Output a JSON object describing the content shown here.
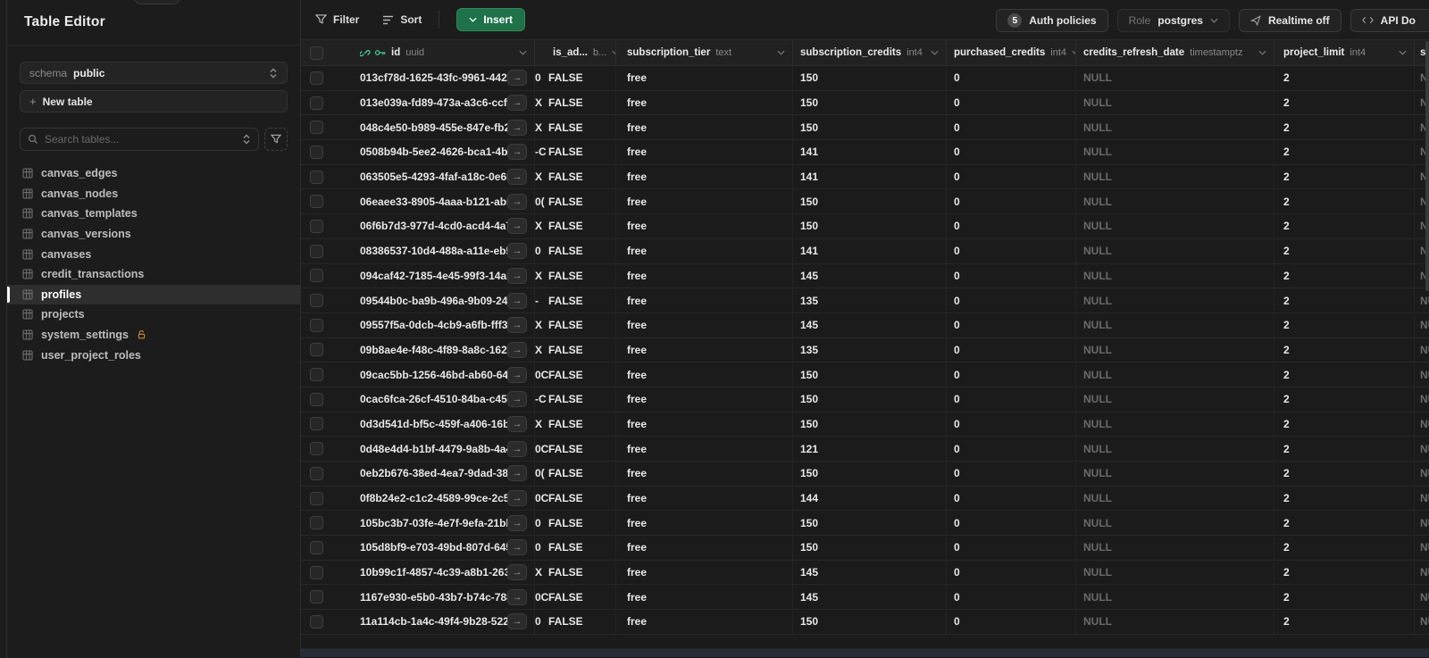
{
  "sidebar": {
    "title": "Table Editor",
    "schema_label": "schema",
    "schema_value": "public",
    "new_table_label": "New table",
    "search_placeholder": "Search tables...",
    "tables": [
      {
        "name": "canvas_edges"
      },
      {
        "name": "canvas_nodes"
      },
      {
        "name": "canvas_templates"
      },
      {
        "name": "canvas_versions"
      },
      {
        "name": "canvases"
      },
      {
        "name": "credit_transactions"
      },
      {
        "name": "profiles",
        "selected": true
      },
      {
        "name": "projects"
      },
      {
        "name": "system_settings",
        "locked": true
      },
      {
        "name": "user_project_roles"
      }
    ]
  },
  "toolbar": {
    "filter_label": "Filter",
    "sort_label": "Sort",
    "insert_label": "Insert",
    "auth_policies_count": "5",
    "auth_policies_label": "Auth policies",
    "role_label": "Role",
    "role_value": "postgres",
    "realtime_label": "Realtime off",
    "api_docs_label": "API Do"
  },
  "icons": {
    "filter": "funnel-icon",
    "sort": "list-icon",
    "insert_chevron": "chevron-down-icon",
    "search": "magnifier-icon",
    "schema_select": "chevrons-up-down-icon",
    "new_table": "plus-icon",
    "table_item": "table-grid-icon",
    "system_settings_lock": "lock-open-icon",
    "id_link": "chain-icon",
    "id_key": "key-icon",
    "expand_row": "arrow-right-icon",
    "realtime": "send-icon",
    "api_docs": "code-brackets-icon"
  },
  "colors": {
    "accent_green": "#3ecf8e",
    "insert_button": "#1e7148",
    "lock_orange": "#c98a2e",
    "background": "#171717"
  },
  "grid": {
    "columns": [
      {
        "key": "id",
        "name": "id",
        "type": "uuid",
        "pk": true
      },
      {
        "key": "frag",
        "name": "",
        "type": ""
      },
      {
        "key": "is_admin",
        "name": "is_ad...",
        "type": "b..."
      },
      {
        "key": "tier",
        "name": "subscription_tier",
        "type": "text"
      },
      {
        "key": "credits",
        "name": "subscription_credits",
        "type": "int4"
      },
      {
        "key": "purchased",
        "name": "purchased_credits",
        "type": "int4"
      },
      {
        "key": "refresh",
        "name": "credits_refresh_date",
        "type": "timestamptz"
      },
      {
        "key": "limit",
        "name": "project_limit",
        "type": "int4"
      },
      {
        "key": "extra",
        "name": "su",
        "type": ""
      }
    ],
    "rows": [
      {
        "id": "013cf78d-1625-43fc-9961-442189...",
        "frag": "0",
        "is_admin": "FALSE",
        "tier": "free",
        "credits": "150",
        "purchased": "0",
        "refresh": "NULL",
        "limit": "2",
        "extra": "NULL"
      },
      {
        "id": "013e039a-fd89-473a-a3c6-ccfa9...",
        "frag": "X",
        "is_admin": "FALSE",
        "tier": "free",
        "credits": "150",
        "purchased": "0",
        "refresh": "NULL",
        "limit": "2",
        "extra": "NULL"
      },
      {
        "id": "048c4e50-b989-455e-847e-fb2f...",
        "frag": "X",
        "is_admin": "FALSE",
        "tier": "free",
        "credits": "150",
        "purchased": "0",
        "refresh": "NULL",
        "limit": "2",
        "extra": "NULL"
      },
      {
        "id": "0508b94b-5ee2-4626-bca1-4bca...",
        "frag": "-C",
        "is_admin": "FALSE",
        "tier": "free",
        "credits": "141",
        "purchased": "0",
        "refresh": "NULL",
        "limit": "2",
        "extra": "NULL"
      },
      {
        "id": "063505e5-4293-4faf-a18c-0e65b...",
        "frag": "X",
        "is_admin": "FALSE",
        "tier": "free",
        "credits": "141",
        "purchased": "0",
        "refresh": "NULL",
        "limit": "2",
        "extra": "NULL"
      },
      {
        "id": "06eaee33-8905-4aaa-b121-ab552...",
        "frag": "0(",
        "is_admin": "FALSE",
        "tier": "free",
        "credits": "150",
        "purchased": "0",
        "refresh": "NULL",
        "limit": "2",
        "extra": "NULL"
      },
      {
        "id": "06f6b7d3-977d-4cd0-acd4-4a78...",
        "frag": "X",
        "is_admin": "FALSE",
        "tier": "free",
        "credits": "150",
        "purchased": "0",
        "refresh": "NULL",
        "limit": "2",
        "extra": "NULL"
      },
      {
        "id": "08386537-10d4-488a-a11e-eb5a6...",
        "frag": "0",
        "is_admin": "FALSE",
        "tier": "free",
        "credits": "141",
        "purchased": "0",
        "refresh": "NULL",
        "limit": "2",
        "extra": "NULL"
      },
      {
        "id": "094caf42-7185-4e45-99f3-14abee...",
        "frag": "X",
        "is_admin": "FALSE",
        "tier": "free",
        "credits": "145",
        "purchased": "0",
        "refresh": "NULL",
        "limit": "2",
        "extra": "NULL"
      },
      {
        "id": "09544b0c-ba9b-496a-9b09-244...",
        "frag": "-",
        "is_admin": "FALSE",
        "tier": "free",
        "credits": "135",
        "purchased": "0",
        "refresh": "NULL",
        "limit": "2",
        "extra": "NULL"
      },
      {
        "id": "09557f5a-0dcb-4cb9-a6fb-fff366...",
        "frag": "X",
        "is_admin": "FALSE",
        "tier": "free",
        "credits": "145",
        "purchased": "0",
        "refresh": "NULL",
        "limit": "2",
        "extra": "NULL"
      },
      {
        "id": "09b8ae4e-f48c-4f89-8a8c-1629b...",
        "frag": "X",
        "is_admin": "FALSE",
        "tier": "free",
        "credits": "135",
        "purchased": "0",
        "refresh": "NULL",
        "limit": "2",
        "extra": "NULL"
      },
      {
        "id": "09cac5bb-1256-46bd-ab60-64ed...",
        "frag": "0C",
        "is_admin": "FALSE",
        "tier": "free",
        "credits": "150",
        "purchased": "0",
        "refresh": "NULL",
        "limit": "2",
        "extra": "NULL"
      },
      {
        "id": "0cac6fca-26cf-4510-84ba-c4580...",
        "frag": "-C",
        "is_admin": "FALSE",
        "tier": "free",
        "credits": "150",
        "purchased": "0",
        "refresh": "NULL",
        "limit": "2",
        "extra": "NULL"
      },
      {
        "id": "0d3d541d-bf5c-459f-a406-16b93...",
        "frag": "X",
        "is_admin": "FALSE",
        "tier": "free",
        "credits": "150",
        "purchased": "0",
        "refresh": "NULL",
        "limit": "2",
        "extra": "NULL"
      },
      {
        "id": "0d48e4d4-b1bf-4479-9a8b-4a4b...",
        "frag": "0C",
        "is_admin": "FALSE",
        "tier": "free",
        "credits": "121",
        "purchased": "0",
        "refresh": "NULL",
        "limit": "2",
        "extra": "NULL"
      },
      {
        "id": "0eb2b676-38ed-4ea7-9dad-38e6...",
        "frag": "0(",
        "is_admin": "FALSE",
        "tier": "free",
        "credits": "150",
        "purchased": "0",
        "refresh": "NULL",
        "limit": "2",
        "extra": "NULL"
      },
      {
        "id": "0f8b24e2-c1c2-4589-99ce-2c52d...",
        "frag": "0C",
        "is_admin": "FALSE",
        "tier": "free",
        "credits": "144",
        "purchased": "0",
        "refresh": "NULL",
        "limit": "2",
        "extra": "NULL"
      },
      {
        "id": "105bc3b7-03fe-4e7f-9efa-21bb40...",
        "frag": "0",
        "is_admin": "FALSE",
        "tier": "free",
        "credits": "150",
        "purchased": "0",
        "refresh": "NULL",
        "limit": "2",
        "extra": "NULL"
      },
      {
        "id": "105d8bf9-e703-49bd-807d-645e...",
        "frag": "0",
        "is_admin": "FALSE",
        "tier": "free",
        "credits": "150",
        "purchased": "0",
        "refresh": "NULL",
        "limit": "2",
        "extra": "NULL"
      },
      {
        "id": "10b99c1f-4857-4c39-a8b1-263b8...",
        "frag": "X",
        "is_admin": "FALSE",
        "tier": "free",
        "credits": "145",
        "purchased": "0",
        "refresh": "NULL",
        "limit": "2",
        "extra": "NULL"
      },
      {
        "id": "1167e930-e5b0-43b7-b74c-788c9...",
        "frag": "0C",
        "is_admin": "FALSE",
        "tier": "free",
        "credits": "145",
        "purchased": "0",
        "refresh": "NULL",
        "limit": "2",
        "extra": "NULL"
      },
      {
        "id": "11a114cb-1a4c-49f4-9b28-52219ec...",
        "frag": "0",
        "is_admin": "FALSE",
        "tier": "free",
        "credits": "150",
        "purchased": "0",
        "refresh": "NULL",
        "limit": "2",
        "extra": "NULL"
      }
    ]
  }
}
